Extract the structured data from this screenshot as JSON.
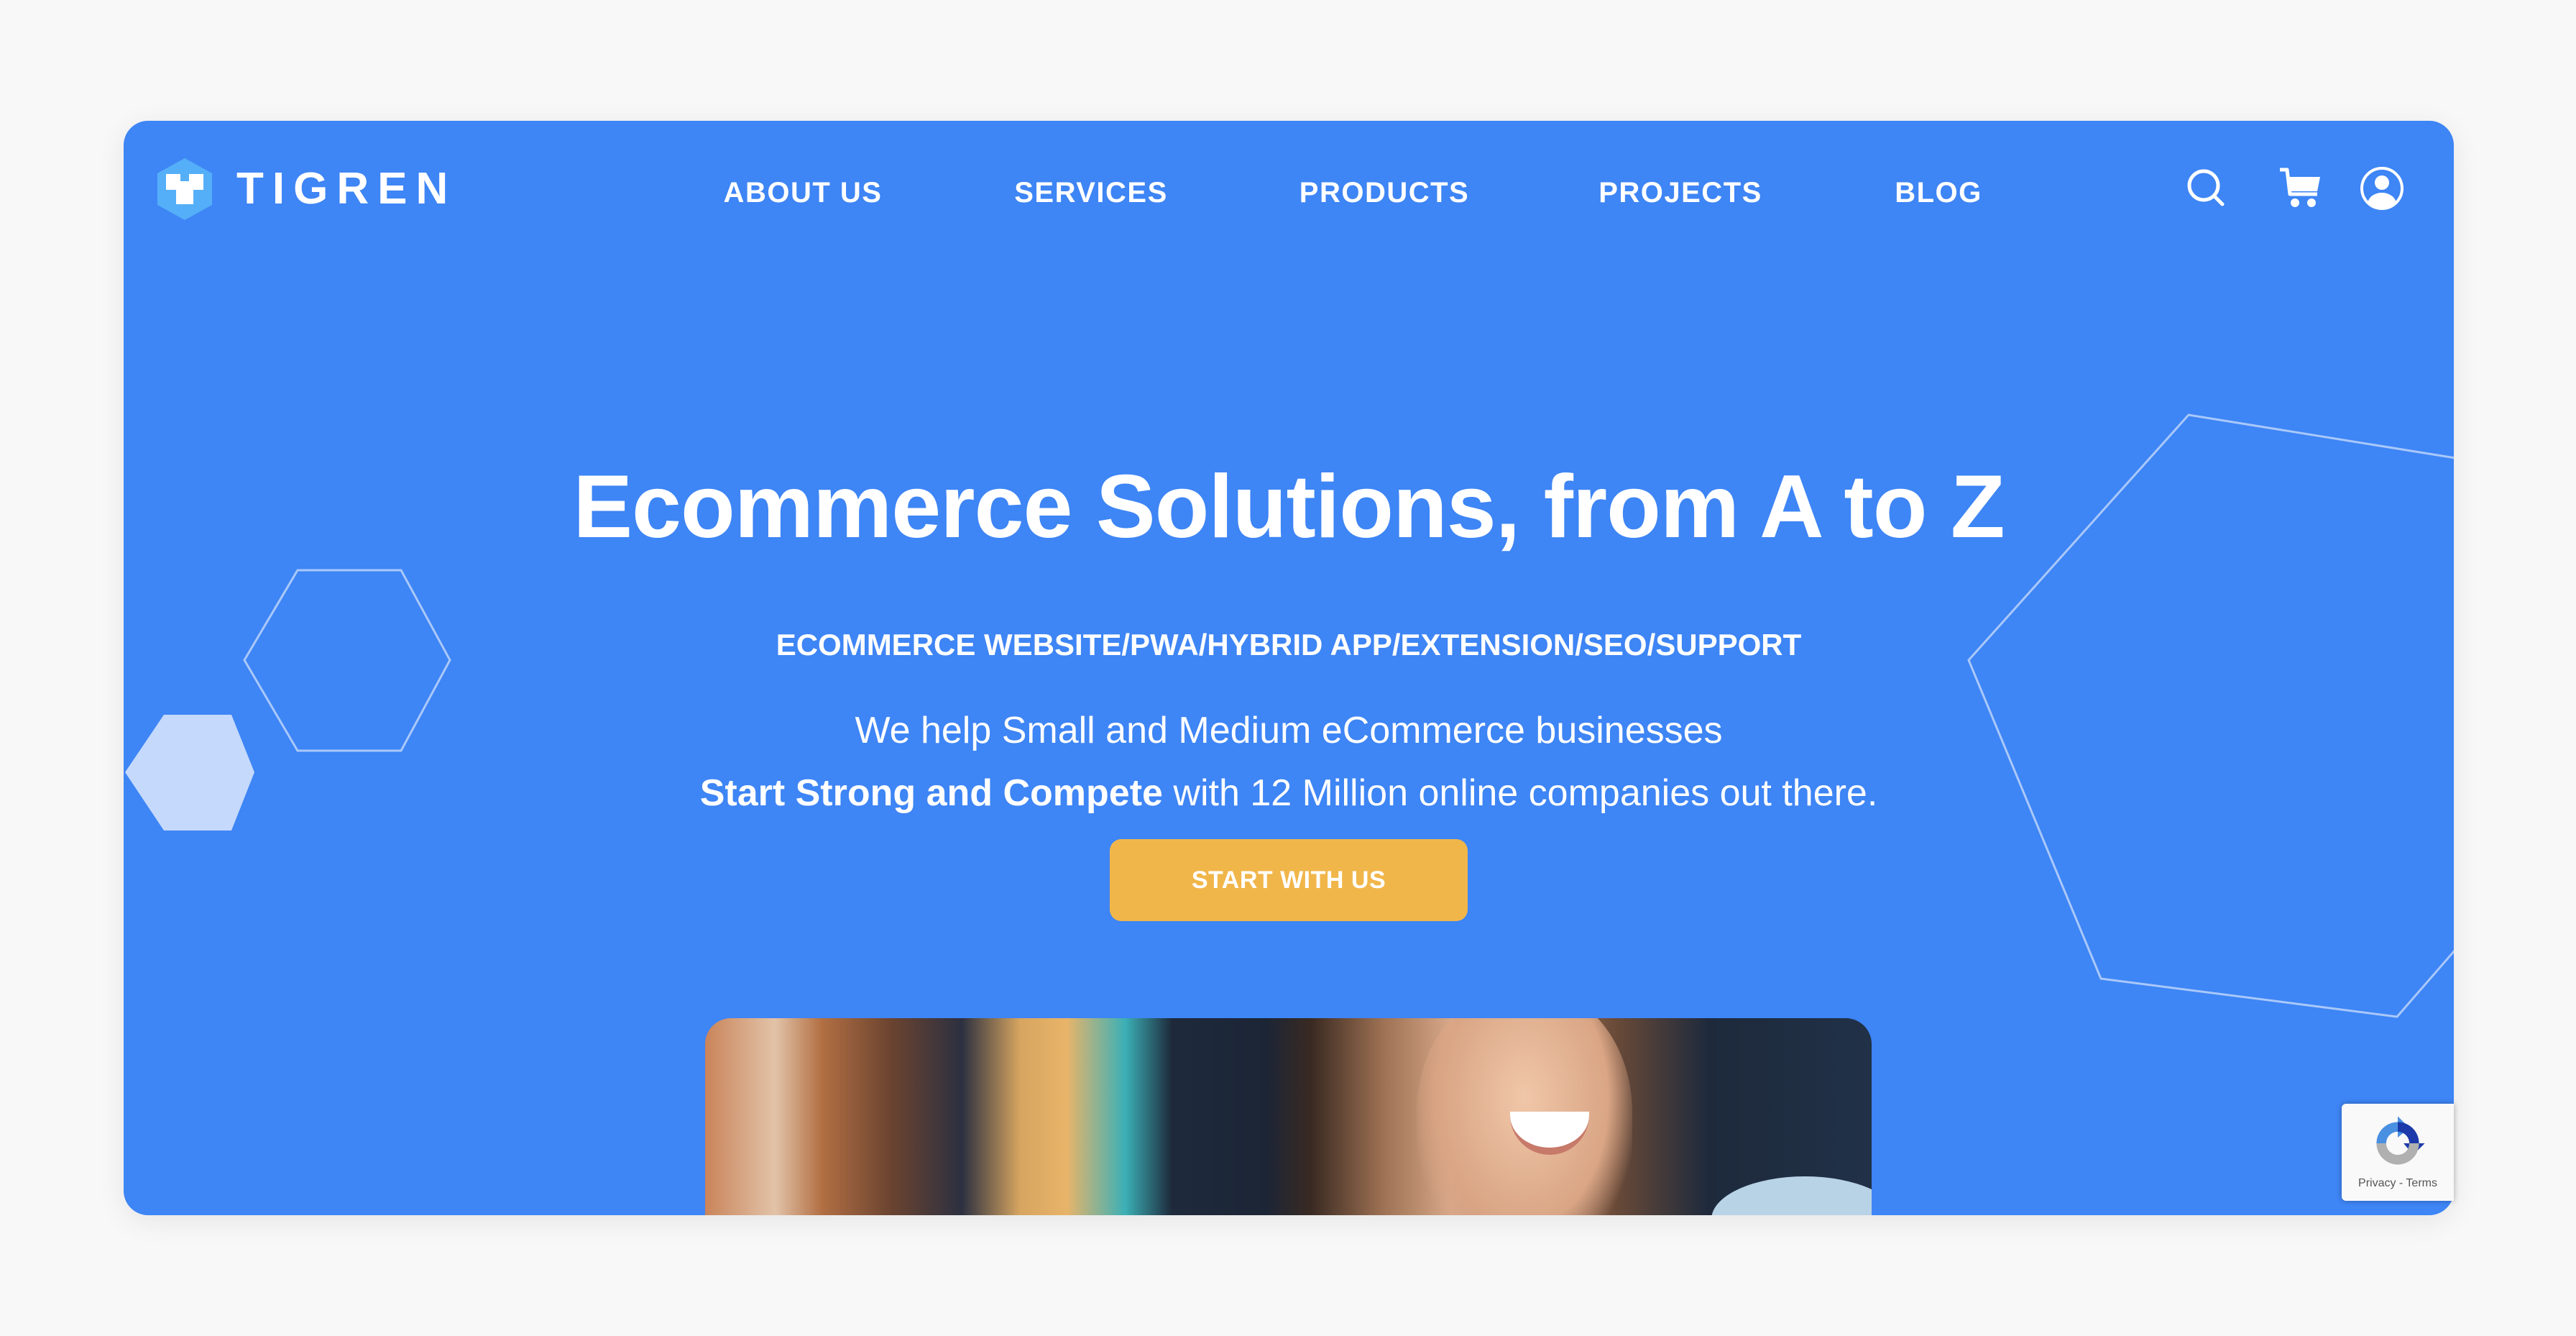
{
  "brand": {
    "name": "TIGREN",
    "logo_icon": "tigren-hex-logo-icon",
    "colors": {
      "primary_blue": "#3e85f5",
      "cta_orange": "#f1b64a",
      "logo_hex": "#55aff8",
      "page_background": "#f8f8f8"
    }
  },
  "nav": {
    "items": [
      {
        "label": "ABOUT US"
      },
      {
        "label": "SERVICES"
      },
      {
        "label": "PRODUCTS"
      },
      {
        "label": "PROJECTS"
      },
      {
        "label": "BLOG"
      }
    ],
    "icons": [
      "search-icon",
      "cart-icon",
      "user-account-icon"
    ]
  },
  "hero": {
    "headline": "Ecommerce Solutions, from A to Z",
    "subheading": "ECOMMERCE WEBSITE/PWA/HYBRID APP/EXTENSION/SEO/SUPPORT",
    "line1": "We help Small and Medium eCommerce businesses",
    "line2_bold": "Start Strong and Compete",
    "line2_rest": " with 12 Million online companies out there.",
    "cta_label": "START WITH US",
    "image_alt": "Smiling woman with curly hair"
  },
  "recaptcha": {
    "links": "Privacy - Terms"
  }
}
